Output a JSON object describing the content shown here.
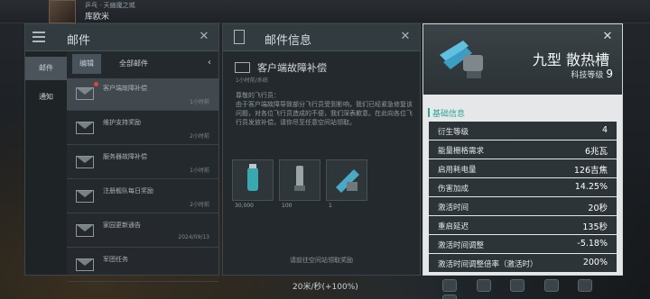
{
  "player": {
    "subtitle": "乒乓 · 天幽魔之城",
    "name": "库欧米"
  },
  "mail_panel": {
    "title": "邮件",
    "sidebar": [
      "邮件",
      "通知"
    ],
    "subtabs": [
      "编辑",
      "全部邮件"
    ],
    "items": [
      {
        "title": "客户端故障补偿",
        "time": "1小时前",
        "unread": true
      },
      {
        "title": "维护支持奖励",
        "time": "2小时前",
        "unread": false
      },
      {
        "title": "服务器故障补偿",
        "time": "1小时前",
        "unread": false
      },
      {
        "title": "注册舰队每日奖励",
        "time": "2小时前",
        "unread": false
      },
      {
        "title": "家园更新通告",
        "time": "2024/09/13",
        "unread": false
      },
      {
        "title": "军团任务",
        "time": "",
        "unread": false
      }
    ]
  },
  "info_panel": {
    "title": "邮件信息",
    "subject": "客户端故障补偿",
    "sender": "1小时前/系统",
    "body": "尊敬的飞行员：\n由于客户端故障导致部分飞行员受到影响，我们已经紧急修复该问题，对各位飞行员造成的不便，我们深表歉意。在此向各位飞行员发放补偿，请你尽至任意空间站领取。",
    "attachments": [
      {
        "icon": "coolant-canister-icon",
        "qty": "30,000"
      },
      {
        "icon": "launcher-icon",
        "qty": "100"
      },
      {
        "icon": "heatsink-module-icon",
        "qty": "1"
      }
    ],
    "claim_hint": "请前往空间站领取奖励"
  },
  "detail_panel": {
    "item_name": "九型 散热槽",
    "tech_label": "科技等级",
    "tech_level": "9",
    "section_title": "基础信息",
    "attributes": [
      {
        "k": "衍生等级",
        "v": "4"
      },
      {
        "k": "能量栅格需求",
        "v": "6兆瓦"
      },
      {
        "k": "启用耗电量",
        "v": "126吉焦"
      },
      {
        "k": "伤害加成",
        "v": "14.25%"
      },
      {
        "k": "激活时间",
        "v": "20秒"
      },
      {
        "k": "重启延迟",
        "v": "135秒"
      },
      {
        "k": "激活时间调整",
        "v": "-5.18%"
      },
      {
        "k": "激活时间调整倍率（激活时）",
        "v": "200%"
      }
    ]
  },
  "status": {
    "speed": "20米/秒(+100%)"
  }
}
